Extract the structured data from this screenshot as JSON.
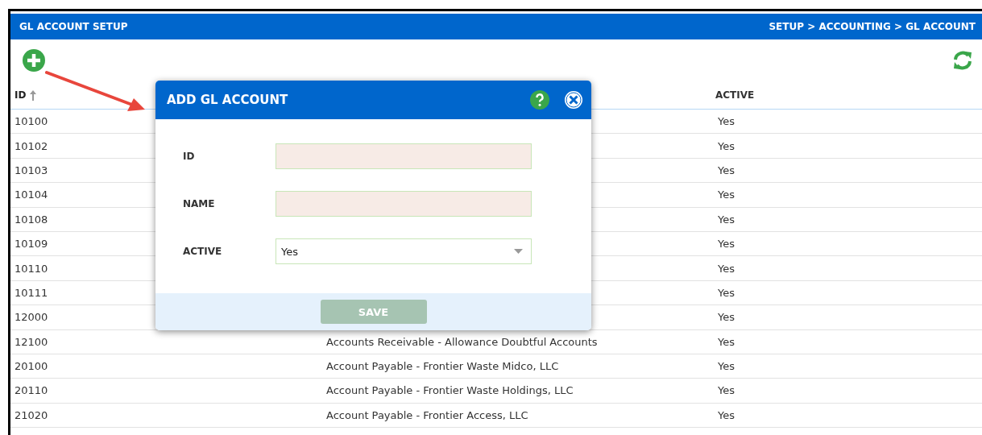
{
  "header": {
    "title": "GL ACCOUNT SETUP",
    "breadcrumb": "SETUP > ACCOUNTING > GL ACCOUNT"
  },
  "table": {
    "columns": [
      {
        "label": "ID",
        "sorted": true
      },
      {
        "label": "ACTIVE",
        "sorted": false
      }
    ],
    "rows": [
      {
        "id": "10100",
        "active": "Yes"
      },
      {
        "id": "10102",
        "active": "Yes"
      },
      {
        "id": "10103",
        "active": "Yes"
      },
      {
        "id": "10104",
        "active": "Yes"
      },
      {
        "id": "10108",
        "active": "Yes"
      },
      {
        "id": "10109",
        "active": "Yes"
      },
      {
        "id": "10110",
        "active": "Yes"
      },
      {
        "id": "10111",
        "active": "Yes"
      },
      {
        "id": "12000",
        "active": "Yes"
      },
      {
        "id": "12100",
        "name": "Accounts Receivable - Allowance Doubtful Accounts",
        "active": "Yes"
      },
      {
        "id": "20100",
        "name": "Account Payable - Frontier Waste Midco, LLC",
        "active": "Yes"
      },
      {
        "id": "20110",
        "name": "Account Payable - Frontier Waste Holdings, LLC",
        "active": "Yes"
      },
      {
        "id": "21020",
        "name": "Account Payable - Frontier Access, LLC",
        "active": "Yes"
      }
    ]
  },
  "dialog": {
    "title": "ADD GL ACCOUNT",
    "fields": [
      {
        "kind": "text",
        "label": "ID"
      },
      {
        "kind": "text",
        "label": "NAME"
      },
      {
        "kind": "select",
        "label": "ACTIVE",
        "value": "Yes"
      }
    ],
    "save_button": {
      "label": "SAVE",
      "disabled": true
    }
  }
}
